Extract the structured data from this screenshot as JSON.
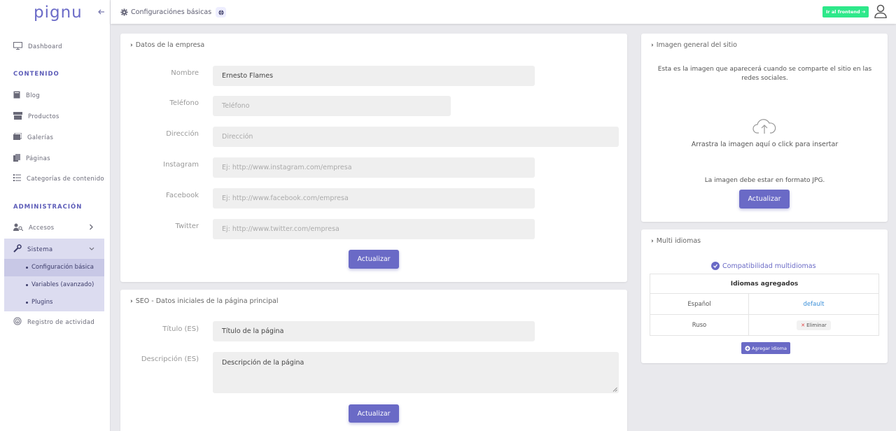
{
  "sidebar": {
    "logo": "pignu",
    "items": {
      "dashboard": "Dashboard",
      "section_content": "CONTENIDO",
      "blog": "Blog",
      "productos": "Productos",
      "galerias": "Galerías",
      "paginas": "Páginas",
      "categorias": "Categorías de contenido",
      "section_admin": "ADMINISTRACIÓN",
      "accesos": "Accesos",
      "sistema": "Sistema",
      "config_basica": "Configuración básica",
      "variables": "Variables (avanzado)",
      "plugins": "Plugins",
      "registro": "Registro de actividad"
    }
  },
  "topbar": {
    "breadcrumb": "Configuraciónes básicas",
    "frontend_button": "Ir al frontend ➔"
  },
  "empresa": {
    "title": "Datos de la empresa",
    "fields": {
      "nombre_label": "Nombre",
      "nombre_value": "Ernesto Flames",
      "telefono_label": "Teléfono",
      "telefono_placeholder": "Teléfono",
      "direccion_label": "Dirección",
      "direccion_placeholder": "Dirección",
      "instagram_label": "Instagram",
      "instagram_placeholder": "Ej: http://www.instagram.com/empresa",
      "facebook_label": "Facebook",
      "facebook_placeholder": "Ej: http://www.facebook.com/empresa",
      "twitter_label": "Twitter",
      "twitter_placeholder": "Ej: http://www.twitter.com/empresa"
    },
    "submit": "Actualizar"
  },
  "seo": {
    "title": "SEO - Datos iniciales de la página principal",
    "titulo_label": "Título (ES)",
    "titulo_value": "Título de la página",
    "descripcion_label": "Descripción (ES)",
    "descripcion_value": "Descripción de la página",
    "submit": "Actualizar"
  },
  "imagen": {
    "title": "Imagen general del sitio",
    "description": "Esta es la imagen que aparecerá cuando se comparte el sitio en las redes sociales.",
    "dropzone": "Arrastra la imagen aquí o click para insertar",
    "format_note": "La imagen debe estar en formato JPG.",
    "submit": "Actualizar"
  },
  "idiomas": {
    "title": "Multi idiomas",
    "compat": "Compatibilidad multidiomas",
    "table_header": "Idiomas agregados",
    "rows": [
      {
        "lang": "Español",
        "action": "default"
      },
      {
        "lang": "Ruso",
        "action": "Eliminar"
      }
    ],
    "add_button": "Agregar idioma"
  },
  "colors": {
    "accent": "#6a6ac6",
    "frontend_btn": "#2ee88a",
    "link": "#3a8fd8",
    "danger": "#e14545"
  }
}
